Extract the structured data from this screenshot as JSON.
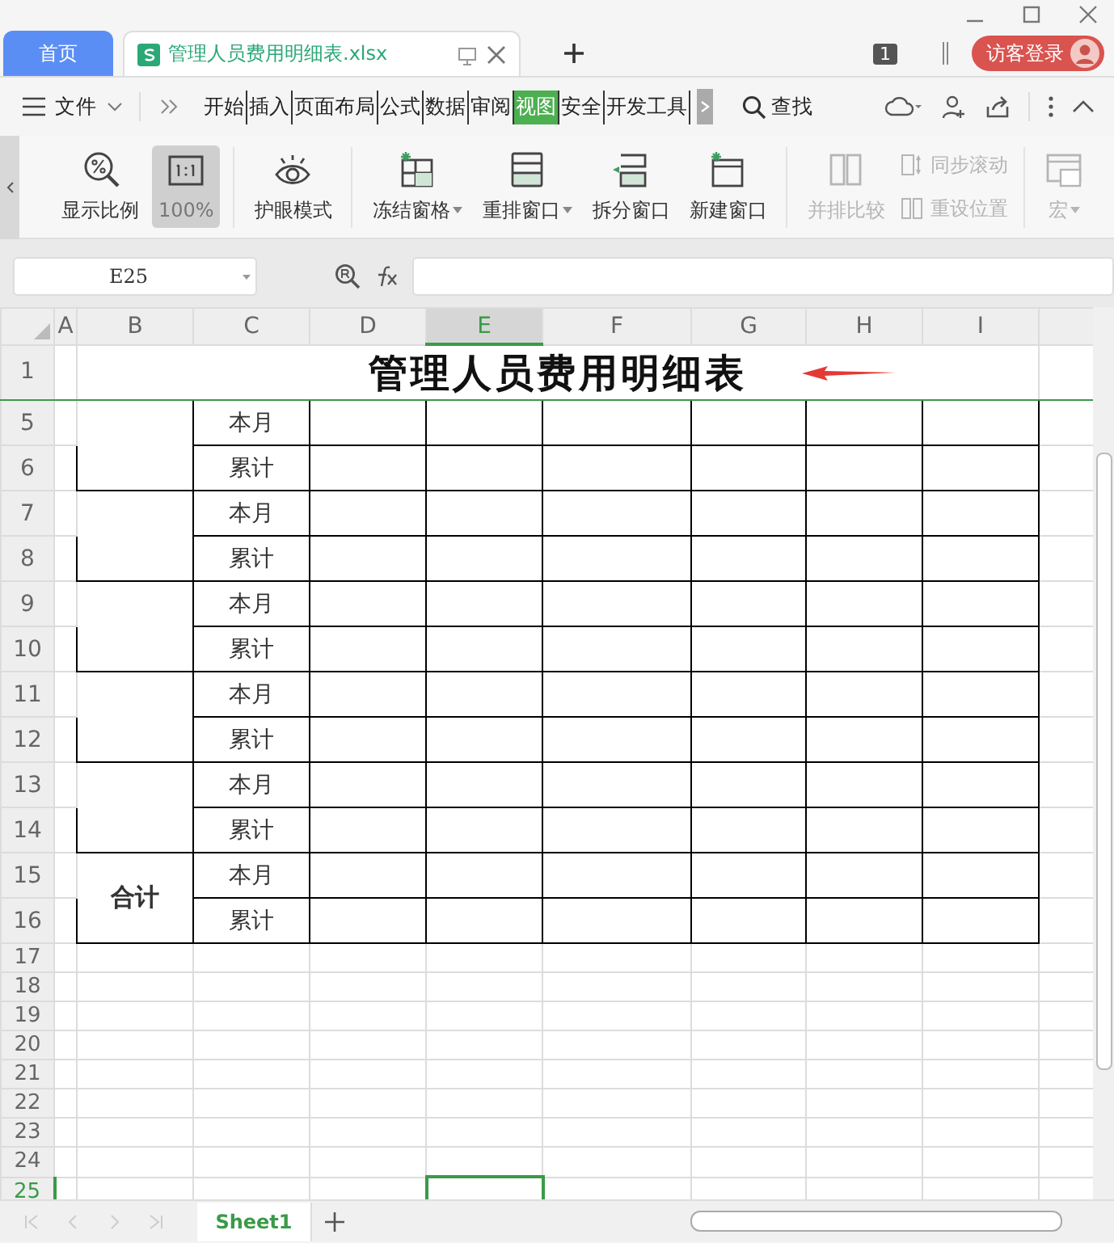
{
  "tabs": [
    {
      "label": "首页",
      "kind": "home",
      "selected": false
    },
    {
      "label": "管理人员费用明细表.xlsx",
      "kind": "document",
      "selected": true
    }
  ],
  "window_badge": "1",
  "login_button": "访客登录",
  "menu": {
    "file": "文件",
    "tabs": [
      {
        "label": "开始",
        "selected": false
      },
      {
        "label": "插入",
        "selected": false
      },
      {
        "label": "页面布局",
        "selected": false
      },
      {
        "label": "公式",
        "selected": false
      },
      {
        "label": "数据",
        "selected": false
      },
      {
        "label": "审阅",
        "selected": false
      },
      {
        "label": "视图",
        "selected": true
      },
      {
        "label": "安全",
        "selected": false
      },
      {
        "label": "开发工具",
        "selected": false
      }
    ],
    "search": "查找"
  },
  "toolbar": [
    {
      "label": "显示比例",
      "kind": "large",
      "selected": false,
      "disabled": false,
      "dropdown": false
    },
    {
      "label": "100%",
      "kind": "large",
      "selected": true,
      "disabled": false,
      "dropdown": false
    },
    {
      "label": "护眼模式",
      "kind": "large",
      "selected": false,
      "disabled": false,
      "dropdown": false
    },
    {
      "label": "冻结窗格",
      "kind": "large",
      "selected": false,
      "disabled": false,
      "dropdown": true
    },
    {
      "label": "重排窗口",
      "kind": "large",
      "selected": false,
      "disabled": false,
      "dropdown": true
    },
    {
      "label": "拆分窗口",
      "kind": "large",
      "selected": false,
      "disabled": false,
      "dropdown": false
    },
    {
      "label": "新建窗口",
      "kind": "large",
      "selected": false,
      "disabled": false,
      "dropdown": false
    },
    {
      "label": "并排比较",
      "kind": "large",
      "selected": false,
      "disabled": true,
      "dropdown": false
    },
    {
      "label": "同步滚动",
      "kind": "small",
      "selected": false,
      "disabled": true,
      "dropdown": false
    },
    {
      "label": "重设位置",
      "kind": "small",
      "selected": false,
      "disabled": true,
      "dropdown": false
    },
    {
      "label": "宏",
      "kind": "large",
      "selected": false,
      "disabled": true,
      "dropdown": true
    }
  ],
  "formula_bar": {
    "name_box": "E25"
  },
  "sheet": {
    "columns": [
      {
        "label": "A",
        "selected": false
      },
      {
        "label": "B",
        "selected": false
      },
      {
        "label": "C",
        "selected": false
      },
      {
        "label": "D",
        "selected": false
      },
      {
        "label": "E",
        "selected": true
      },
      {
        "label": "F",
        "selected": false
      },
      {
        "label": "G",
        "selected": false
      },
      {
        "label": "H",
        "selected": false
      },
      {
        "label": "I",
        "selected": false
      }
    ],
    "title_row": {
      "number": "1",
      "text": "管理人员费用明细表"
    },
    "groups": [
      {
        "rows": [
          {
            "number": "5",
            "label": "本月"
          },
          {
            "number": "6",
            "label": "累计"
          }
        ]
      },
      {
        "rows": [
          {
            "number": "7",
            "label": "本月"
          },
          {
            "number": "8",
            "label": "累计"
          }
        ]
      },
      {
        "rows": [
          {
            "number": "9",
            "label": "本月"
          },
          {
            "number": "10",
            "label": "累计"
          }
        ]
      },
      {
        "rows": [
          {
            "number": "11",
            "label": "本月"
          },
          {
            "number": "12",
            "label": "累计"
          }
        ]
      },
      {
        "rows": [
          {
            "number": "13",
            "label": "本月"
          },
          {
            "number": "14",
            "label": "累计"
          }
        ]
      },
      {
        "label": "合计",
        "rows": [
          {
            "number": "15",
            "label": "本月"
          },
          {
            "number": "16",
            "label": "累计"
          }
        ]
      }
    ],
    "empty_rows": [
      {
        "number": "17",
        "selected": false
      },
      {
        "number": "18",
        "selected": false
      },
      {
        "number": "19",
        "selected": false
      },
      {
        "number": "20",
        "selected": false
      },
      {
        "number": "21",
        "selected": false
      },
      {
        "number": "22",
        "selected": false
      },
      {
        "number": "23",
        "selected": false
      },
      {
        "number": "24",
        "selected": false
      },
      {
        "number": "25",
        "selected": true
      }
    ]
  },
  "sheet_tabs": [
    {
      "label": "Sheet1",
      "selected": true
    }
  ]
}
